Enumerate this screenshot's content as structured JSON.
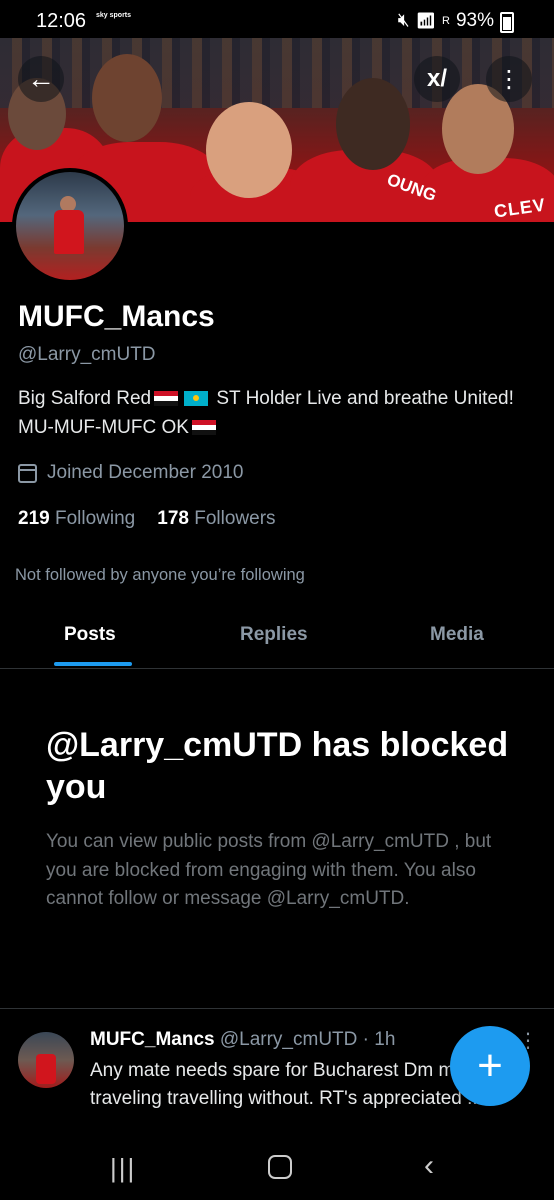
{
  "status_bar": {
    "time": "12:06",
    "notif_label": "sky sports",
    "signal_label": "R",
    "battery": "93%"
  },
  "banner": {
    "jersey_text_1": "OUNG",
    "jersey_text_2": "CLEV"
  },
  "profile": {
    "name": "MUFC_Mancs",
    "handle": "@Larry_cmUTD",
    "bio_1": "Big Salford Red",
    "bio_2": " ST Holder Live and breathe United! MU-MUF-MUFC OK",
    "joined": "Joined December 2010",
    "following_count": "219",
    "following_label": "Following",
    "followers_count": "178",
    "followers_label": "Followers",
    "not_followed": "Not followed by anyone you’re following"
  },
  "tabs": [
    {
      "label": "Posts"
    },
    {
      "label": "Replies"
    },
    {
      "label": "Media"
    }
  ],
  "blocked": {
    "title": "@Larry_cmUTD has blocked you",
    "text": "You can view public posts from @Larry_cmUTD , but you are blocked from engaging with them. You also cannot follow or message @Larry_cmUTD."
  },
  "post": {
    "name": "MUFC_Mancs",
    "meta": " @Larry_cmUTD · 1h",
    "text": "Any mate needs spare for Bucharest Dm me if traveling travelling without. RT's appreciated !!"
  },
  "fab": {
    "icon": "+"
  },
  "colors": {
    "accent": "#1d9bf0",
    "background": "#000000",
    "muted_text": "#8b98a5"
  }
}
